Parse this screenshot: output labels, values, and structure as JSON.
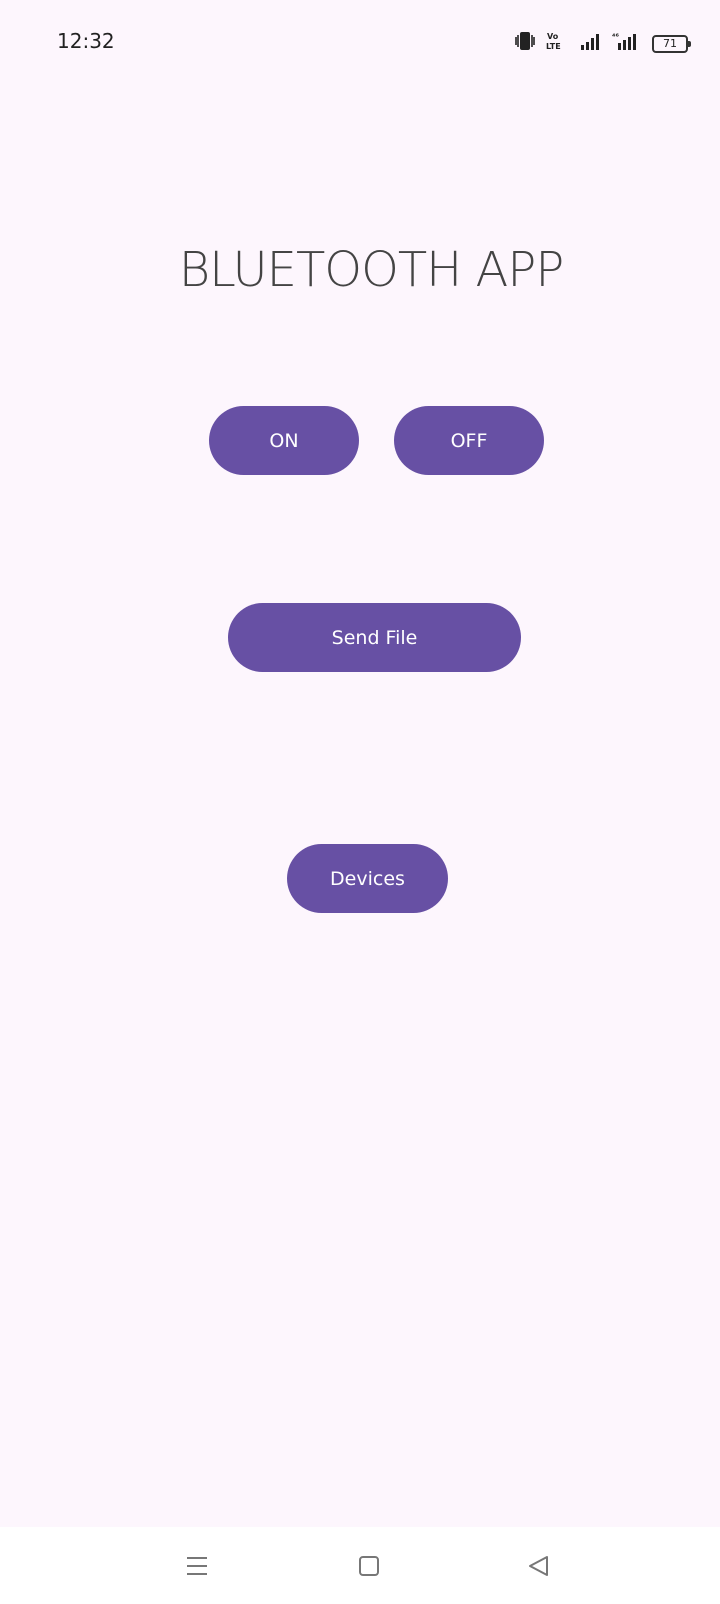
{
  "status_bar": {
    "time": "12:32",
    "battery_level": "71",
    "icons": [
      "vibrate-icon",
      "volte-icon",
      "signal-icon",
      "4g-signal-icon",
      "battery-icon"
    ]
  },
  "app": {
    "title": "BLUETOOTH APP"
  },
  "buttons": {
    "on_label": "ON",
    "off_label": "OFF",
    "send_file_label": "Send File",
    "devices_label": "Devices"
  },
  "nav_bar": {
    "icons": [
      "menu-icon",
      "home-icon",
      "back-icon"
    ]
  },
  "colors": {
    "background": "#fdf6fd",
    "button": "#6750a4",
    "button_text": "#ffffff",
    "title_text": "#444444"
  }
}
